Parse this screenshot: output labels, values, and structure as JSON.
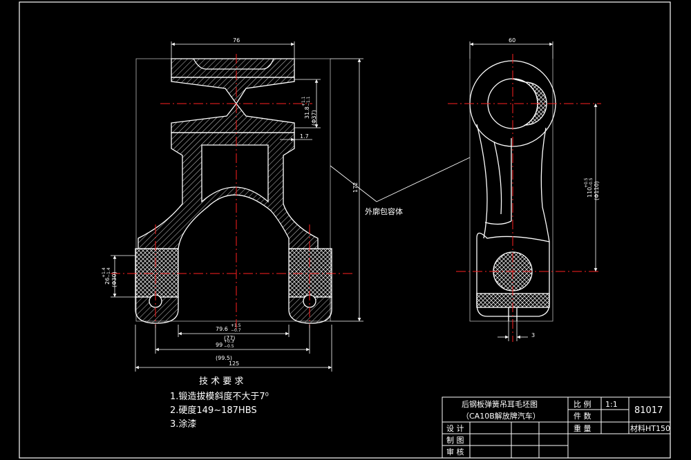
{
  "colors": {
    "background": "#000000",
    "outline": "#ffffff",
    "centerline": "#ff2020",
    "hatch": "#d0d0d0"
  },
  "front_view": {
    "dim_width_top": "76",
    "dim_overall_height": "172",
    "dim_bore": "31.8",
    "dim_bore_tol_upper": "+1.1",
    "dim_bore_tol_lower": "−1.1",
    "dim_bore_ref": "(Φ37)",
    "dim_rib": "1.7",
    "dim_pin": "26",
    "dim_pin_tol_upper": "+1.4",
    "dim_pin_tol_lower": "−1.4",
    "dim_pin_ref": "(Φ30)",
    "dim_inner": "79.6",
    "dim_inner_tol_upper": "+1.5",
    "dim_inner_tol_lower": "−0.7",
    "dim_inner_ref": "(77)",
    "dim_mid": "99",
    "dim_mid_tol_upper": "+0.3",
    "dim_mid_tol_lower": "−0.5",
    "dim_mid_ref": "(99.5)",
    "dim_overall_width": "125"
  },
  "side_view": {
    "dim_width": "60",
    "dim_centers": "110",
    "dim_centers_tol_upper": "+0.5",
    "dim_centers_tol_lower": "−0.5",
    "dim_centers_ref": "(Φ110)",
    "dim_slot": "3"
  },
  "annotation": "外廓包容体",
  "tech_req": {
    "heading": "技 术 要 求",
    "items": [
      "1.锻造拔模斜度不大于7⁰",
      "2.硬度149~187HBS",
      "3.涂漆"
    ]
  },
  "title_block": {
    "title_line1": "后钢板弹簧吊耳毛坯图",
    "title_line2": "（CA10B解放牌汽车）",
    "scale_label": "比 例",
    "scale_value": "1:1",
    "quantity_label": "件 数",
    "weight_label": "重 量",
    "drawing_no": "81017",
    "material": "材料HT150",
    "designer_label": "设 计",
    "drafter_label": "制 图",
    "checker_label": "审 核"
  }
}
